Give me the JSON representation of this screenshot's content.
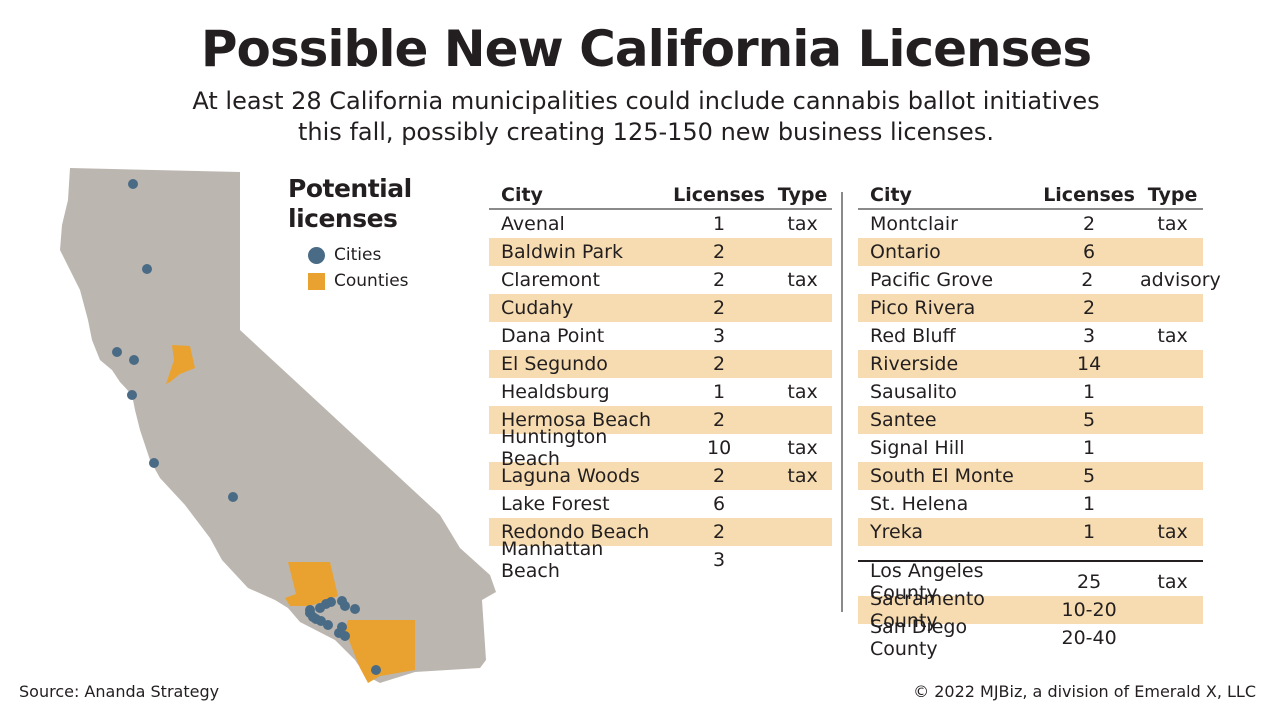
{
  "title": "Possible New California Licenses",
  "subtitle_line1": "At least 28 California municipalities could include cannabis ballot initiatives",
  "subtitle_line2": "this fall, possibly creating 125-150 new business licenses.",
  "legend": {
    "title_line1": "Potential",
    "title_line2": "licenses",
    "items": [
      {
        "label": "Cities",
        "color": "#4a6b85",
        "shape": "circle"
      },
      {
        "label": "Counties",
        "color": "#e9a22f",
        "shape": "square"
      }
    ]
  },
  "colors": {
    "map_fill": "#bcb6b0",
    "city_dot": "#4a6b85",
    "county_fill": "#e9a22f",
    "row_highlight": "#f6dcb0"
  },
  "chart_data": {
    "type": "table",
    "title": "Possible New California Licenses",
    "columns": [
      "City",
      "Licenses",
      "Type"
    ],
    "left_table": [
      {
        "city": "Avenal",
        "licenses": "1",
        "type": "tax"
      },
      {
        "city": "Baldwin Park",
        "licenses": "2",
        "type": ""
      },
      {
        "city": "Claremont",
        "licenses": "2",
        "type": "tax"
      },
      {
        "city": "Cudahy",
        "licenses": "2",
        "type": ""
      },
      {
        "city": "Dana Point",
        "licenses": "3",
        "type": ""
      },
      {
        "city": "El Segundo",
        "licenses": "2",
        "type": ""
      },
      {
        "city": "Healdsburg",
        "licenses": "1",
        "type": "tax"
      },
      {
        "city": "Hermosa Beach",
        "licenses": "2",
        "type": ""
      },
      {
        "city": "Huntington Beach",
        "licenses": "10",
        "type": "tax"
      },
      {
        "city": "Laguna Woods",
        "licenses": "2",
        "type": "tax"
      },
      {
        "city": "Lake Forest",
        "licenses": "6",
        "type": ""
      },
      {
        "city": "Redondo Beach",
        "licenses": "2",
        "type": ""
      },
      {
        "city": "Manhattan Beach",
        "licenses": "3",
        "type": ""
      }
    ],
    "right_table": [
      {
        "city": "Montclair",
        "licenses": "2",
        "type": "tax"
      },
      {
        "city": "Ontario",
        "licenses": "6",
        "type": ""
      },
      {
        "city": "Pacific Grove",
        "licenses": "2",
        "type": "advisory"
      },
      {
        "city": "Pico Rivera",
        "licenses": "2",
        "type": ""
      },
      {
        "city": "Red Bluff",
        "licenses": "3",
        "type": "tax"
      },
      {
        "city": "Riverside",
        "licenses": "14",
        "type": ""
      },
      {
        "city": "Sausalito",
        "licenses": "1",
        "type": ""
      },
      {
        "city": "Santee",
        "licenses": "5",
        "type": ""
      },
      {
        "city": "Signal Hill",
        "licenses": "1",
        "type": ""
      },
      {
        "city": "South El Monte",
        "licenses": "5",
        "type": ""
      },
      {
        "city": "St. Helena",
        "licenses": "1",
        "type": ""
      },
      {
        "city": "Yreka",
        "licenses": "1",
        "type": "tax"
      }
    ],
    "counties": [
      {
        "city": "Los Angeles County",
        "licenses": "25",
        "type": "tax"
      },
      {
        "city": "Sacramento County",
        "licenses": "10-20",
        "type": ""
      },
      {
        "city": "San Diego County",
        "licenses": "20-40",
        "type": ""
      }
    ]
  },
  "footer": {
    "source": "Source: Ananda Strategy",
    "copyright": "© 2022 MJBiz, a division of Emerald X, LLC"
  }
}
